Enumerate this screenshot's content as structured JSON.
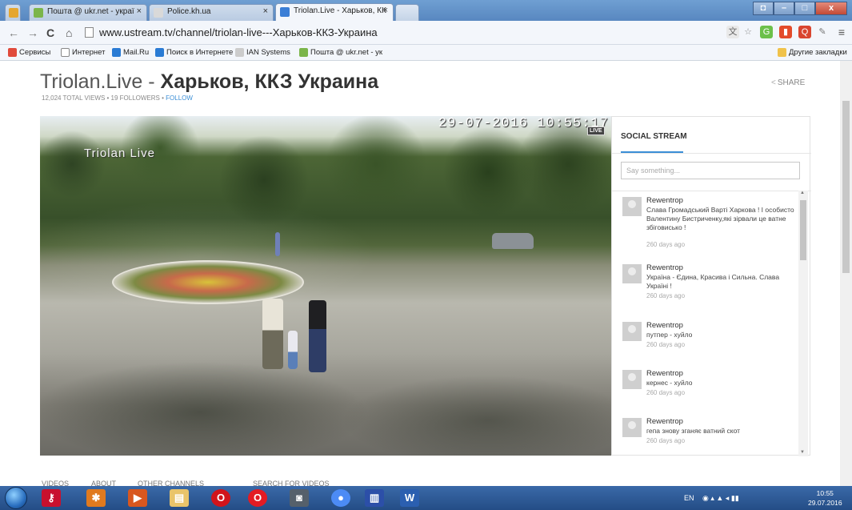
{
  "browser": {
    "tabs": [
      {
        "label": "Пошта @ ukr.net - украї",
        "icon_color": "#7bb54a"
      },
      {
        "label": "Police.kh.ua",
        "icon_color": "#d9d9d9"
      },
      {
        "label": "Triolan.Live - Харьков, КК",
        "icon_color": "#3b7ed6"
      }
    ],
    "url": "www.ustream.tv/channel/triolan-live---Харьков-ККЗ-Украина",
    "bookmarks": [
      {
        "label": "Сервисы",
        "color": "#e04a3b"
      },
      {
        "label": "Интернет",
        "color": "#ffffff"
      },
      {
        "label": "Mail.Ru",
        "color": "#2a7bd4"
      },
      {
        "label": "Поиск в Интернете",
        "color": "#2a7bd4"
      },
      {
        "label": "IAN Systems",
        "color": "#cccccc"
      },
      {
        "label": "Пошта @ ukr.net - ук",
        "color": "#7bb54a"
      },
      {
        "label": "Другие закладки",
        "color": "#f0c24a"
      }
    ]
  },
  "channel": {
    "title_prefix": "Triolan.Live - ",
    "title_bold": "Харьков, ККЗ Украина",
    "meta": "12,024 TOTAL VIEWS • 19 FOLLOWERS • ",
    "follow_label": "FOLLOW",
    "share_label": "SHARE"
  },
  "video": {
    "brand": "Triolan Live",
    "timestamp": "29-07-2016 10:55:17",
    "live_badge": "LIVE"
  },
  "social": {
    "title": "SOCIAL STREAM",
    "input_placeholder": "Say something...",
    "posts": [
      {
        "user": "Rewentrop",
        "message": "Слава Громадський Варті Харкова ! І особисто Валентину Бистриченку,які зірвали це ватне збіговисько !",
        "ago": "260 days ago"
      },
      {
        "user": "Rewentrop",
        "message": "Україна - Єдина, Красива і Сильна. Слава Україні !",
        "ago": "260 days ago"
      },
      {
        "user": "Rewentrop",
        "message": "путпер - хуйло",
        "ago": "260 days ago"
      },
      {
        "user": "Rewentrop",
        "message": "кернес - хуйло",
        "ago": "260 days ago"
      },
      {
        "user": "Rewentrop",
        "message": "гепа знову зганяє ватний скот",
        "ago": "260 days ago"
      }
    ]
  },
  "subnav": {
    "items": [
      "VIDEOS",
      "ABOUT",
      "OTHER CHANNELS",
      "SEARCH FOR VIDEOS"
    ]
  },
  "taskbar": {
    "lang": "EN",
    "time": "10:55",
    "date": "29.07.2016"
  }
}
